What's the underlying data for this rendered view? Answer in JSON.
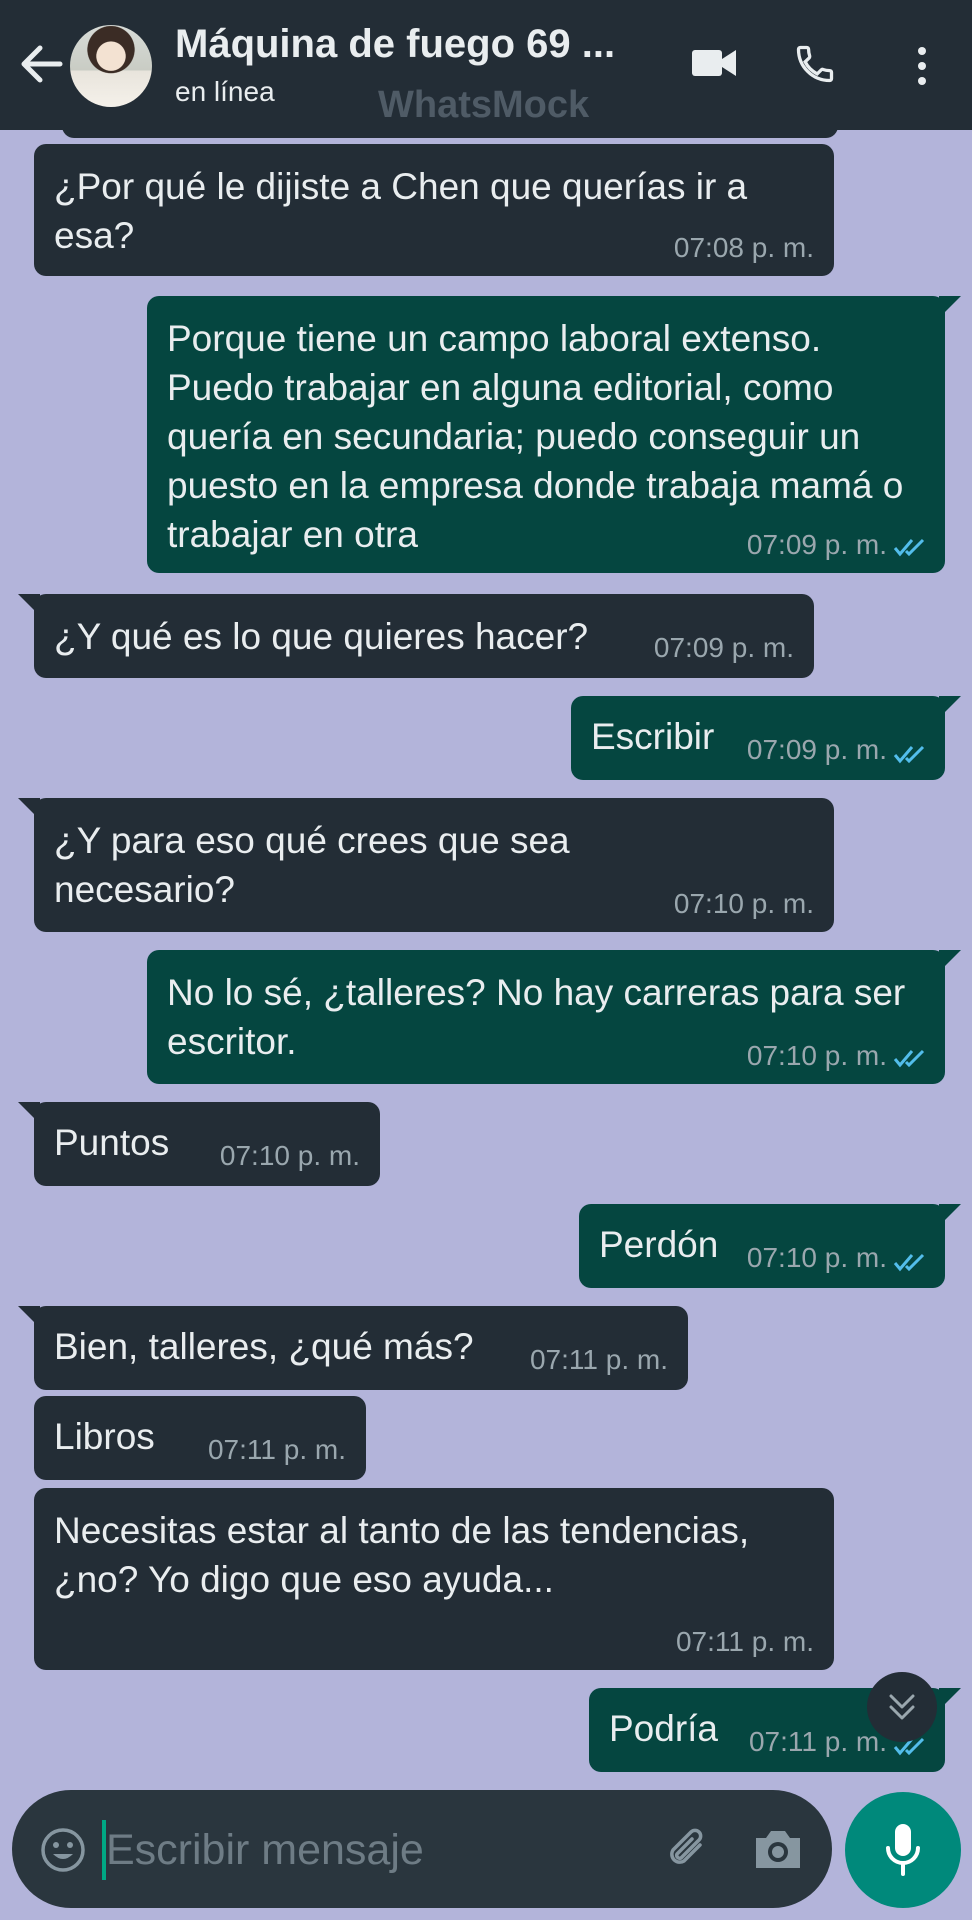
{
  "header": {
    "contact_name": "Máquina de fuego 69 ...",
    "status": "en línea",
    "watermark": "WhatsMock"
  },
  "messages": [
    {
      "direction": "in",
      "text": "¿Por qué le dijiste a Chen que querías ir a esa?",
      "time": "07:08 p. m."
    },
    {
      "direction": "out",
      "text": "Porque tiene un campo laboral extenso. Puedo trabajar en alguna editorial, como quería en secundaria; puedo conseguir un puesto en la empresa donde trabaja mamá o trabajar en otra",
      "time": "07:09 p. m.",
      "read": true
    },
    {
      "direction": "in",
      "text": "¿Y qué es lo que quieres hacer?",
      "time": "07:09 p. m."
    },
    {
      "direction": "out",
      "text": "Escribir",
      "time": "07:09 p. m.",
      "read": true
    },
    {
      "direction": "in",
      "text": "¿Y para eso qué crees que sea necesario?",
      "time": "07:10 p. m."
    },
    {
      "direction": "out",
      "text": "No lo sé, ¿talleres? No hay carreras para ser escritor.",
      "time": "07:10 p. m.",
      "read": true
    },
    {
      "direction": "in",
      "text": "Puntos",
      "time": "07:10 p. m."
    },
    {
      "direction": "out",
      "text": "Perdón",
      "time": "07:10 p. m.",
      "read": true
    },
    {
      "direction": "in",
      "text": "Bien, talleres, ¿qué más?",
      "time": "07:11 p. m."
    },
    {
      "direction": "in",
      "text": "Libros",
      "time": "07:11 p. m."
    },
    {
      "direction": "in",
      "text": "Necesitas estar al tanto de las tendencias, ¿no? Yo digo que eso ayuda...",
      "time": "07:11 p. m."
    },
    {
      "direction": "out",
      "text": "Podría",
      "time": "07:11 p. m.",
      "read": true
    }
  ],
  "input": {
    "placeholder": "Escribir mensaje"
  },
  "icons": {
    "back": "arrow-left-icon",
    "video": "video-camera-icon",
    "phone": "phone-icon",
    "menu": "more-vert-icon",
    "emoji": "emoji-icon",
    "attach": "paperclip-icon",
    "camera": "camera-icon",
    "mic": "mic-icon",
    "scroll": "double-chevron-down-icon"
  },
  "colors": {
    "background": "#b3b4da",
    "incoming_bubble": "#232d36",
    "outgoing_bubble": "#054640",
    "read_tick": "#53bdeb",
    "accent": "#00897b"
  }
}
